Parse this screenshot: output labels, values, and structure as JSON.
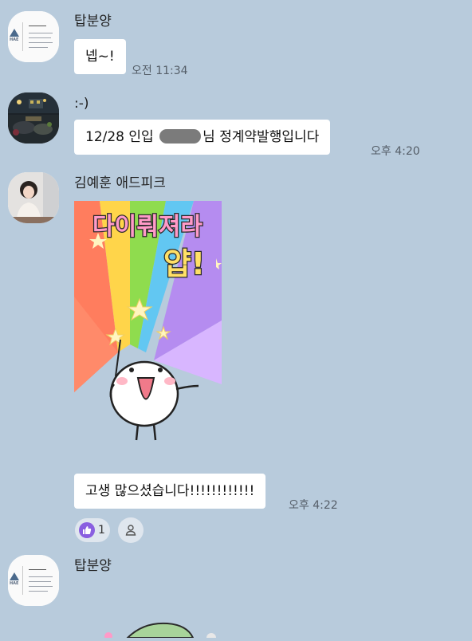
{
  "messages": [
    {
      "sender": "탑분양",
      "text": "넵~!",
      "time": "오전 11:34"
    },
    {
      "sender": ":-)",
      "text_before": "12/28 인입 ",
      "text_after": "님 정계약발행입니다",
      "time": "오후 4:20"
    },
    {
      "sender": "김예훈 애드피크",
      "sticker": {
        "line1": "다이뤄져라",
        "line2": "얍!"
      }
    },
    {
      "text": "고생 많으셨습니다!!!!!!!!!!!!",
      "time": "오후 4:22"
    },
    {
      "sender": "탑분양"
    }
  ],
  "reactions": {
    "like_count": "1"
  },
  "colors": {
    "background": "#b8cbdc",
    "bubble": "#ffffff",
    "like": "#8a5fe0"
  }
}
